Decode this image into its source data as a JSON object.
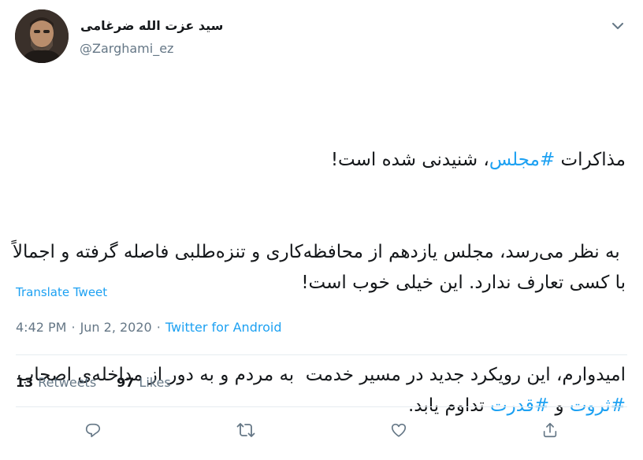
{
  "user": {
    "name": "سید عزت الله ضرغامی",
    "handle": "@Zarghami_ez"
  },
  "tweet": {
    "p1_pre": "مذاکرات ",
    "p1_tag": "#مجلس",
    "p1_post": "، شنیدنی شده است!",
    "p2": " به نظر می‌رسد، مجلس یازدهم از محافظه‌کاری و تنزه‌طلبی فاصله گرفته و اجمالاً با کسی تعارف ندارد. این خیلی خوب است!",
    "p3_pre": "امیدوارم، این رویکرد جدید در مسیر خدمت  به مردم و به دور از مداخله‌ی اصحاب ",
    "p3_tag1": "#ثروت",
    "p3_mid": " و ",
    "p3_tag2": "#قدرت",
    "p3_post": " تداوم یابد."
  },
  "translate_label": "Translate Tweet",
  "meta": {
    "time": "4:42 PM",
    "sep1": "·",
    "date": "Jun 2, 2020",
    "sep2": "·",
    "source": "Twitter for Android"
  },
  "stats": {
    "retweets_count": "13",
    "retweets_label": "Retweets",
    "likes_count": "97",
    "likes_label": "Likes"
  },
  "icons": {
    "menu": "chevron-down-icon",
    "reply": "reply-icon",
    "retweet": "retweet-icon",
    "like": "heart-icon",
    "share": "share-icon"
  },
  "colors": {
    "accent": "#1da1f2",
    "muted": "#657786",
    "text": "#14171a",
    "divider": "#e6ecf0"
  }
}
